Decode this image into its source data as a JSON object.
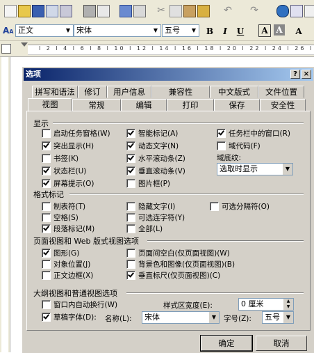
{
  "toolbar": {
    "style": "正文",
    "font": "宋体",
    "size": "五号",
    "bold": "B",
    "italic": "I",
    "underline": "U",
    "fontcolor": "A",
    "highlight": "A",
    "style_icon": "A"
  },
  "ruler": {
    "ticks": "l 2 l 4 l 6 l 8 l 10 l 12 l 14 l 16 l 18 l 20 l 22 l 24 l 26 l"
  },
  "dialog": {
    "title": "选项",
    "help": "?",
    "close": "×",
    "tabs_row1": [
      "拼写和语法",
      "修订",
      "用户信息",
      "兼容性",
      "中文版式",
      "文件位置"
    ],
    "tabs_row2": [
      "视图",
      "常规",
      "编辑",
      "打印",
      "保存",
      "安全性"
    ],
    "display": {
      "heading": "显示",
      "col1": [
        {
          "label": "启动任务窗格(W)",
          "checked": false
        },
        {
          "label": "突出显示(H)",
          "checked": true
        },
        {
          "label": "书签(K)",
          "checked": false
        },
        {
          "label": "状态栏(U)",
          "checked": true
        },
        {
          "label": "屏幕提示(O)",
          "checked": true
        }
      ],
      "col2": [
        {
          "label": "智能标记(A)",
          "checked": true
        },
        {
          "label": "动态文字(N)",
          "checked": true
        },
        {
          "label": "水平滚动条(Z)",
          "checked": true
        },
        {
          "label": "垂直滚动条(V)",
          "checked": true
        },
        {
          "label": "图片框(P)",
          "checked": false
        }
      ],
      "col3": [
        {
          "label": "任务栏中的窗口(R)",
          "checked": true
        },
        {
          "label": "域代码(F)",
          "checked": false
        }
      ],
      "field_shading_label": "域底纹:",
      "field_shading_value": "选取时显示"
    },
    "format": {
      "heading": "格式标记",
      "col1": [
        {
          "label": "制表符(T)",
          "checked": false
        },
        {
          "label": "空格(S)",
          "checked": false
        },
        {
          "label": "段落标记(M)",
          "checked": true
        }
      ],
      "col2": [
        {
          "label": "隐藏文字(I)",
          "checked": false
        },
        {
          "label": "可选连字符(Y)",
          "checked": false
        },
        {
          "label": "全部(L)",
          "checked": false
        }
      ],
      "col3": [
        {
          "label": "可选分隔符(O)",
          "checked": false
        }
      ]
    },
    "layout": {
      "heading": "页面视图和 Web 版式视图选项",
      "col1": [
        {
          "label": "图形(G)",
          "checked": true
        },
        {
          "label": "对象位置(J)",
          "checked": false
        },
        {
          "label": "正文边框(X)",
          "checked": false
        }
      ],
      "col2": [
        {
          "label": "页面间空白(仅页面视图)(W)",
          "checked": false
        },
        {
          "label": "背景色和图像(仅页面视图)(B)",
          "checked": false
        },
        {
          "label": "垂直标尺(仅页面视图)(C)",
          "checked": true
        }
      ]
    },
    "outline": {
      "heading": "大纲视图和普通视图选项",
      "wrap": {
        "label": "窗口内自动换行(W)",
        "checked": false
      },
      "draft": {
        "label": "草稿字体(D):",
        "checked": true
      },
      "style_width_label": "样式区宽度(E):",
      "style_width_value": "0 厘米",
      "name_label": "名称(L):",
      "name_value": "宋体",
      "size_label": "字号(Z):",
      "size_value": "五号"
    },
    "ok": "确定",
    "cancel": "取消"
  }
}
